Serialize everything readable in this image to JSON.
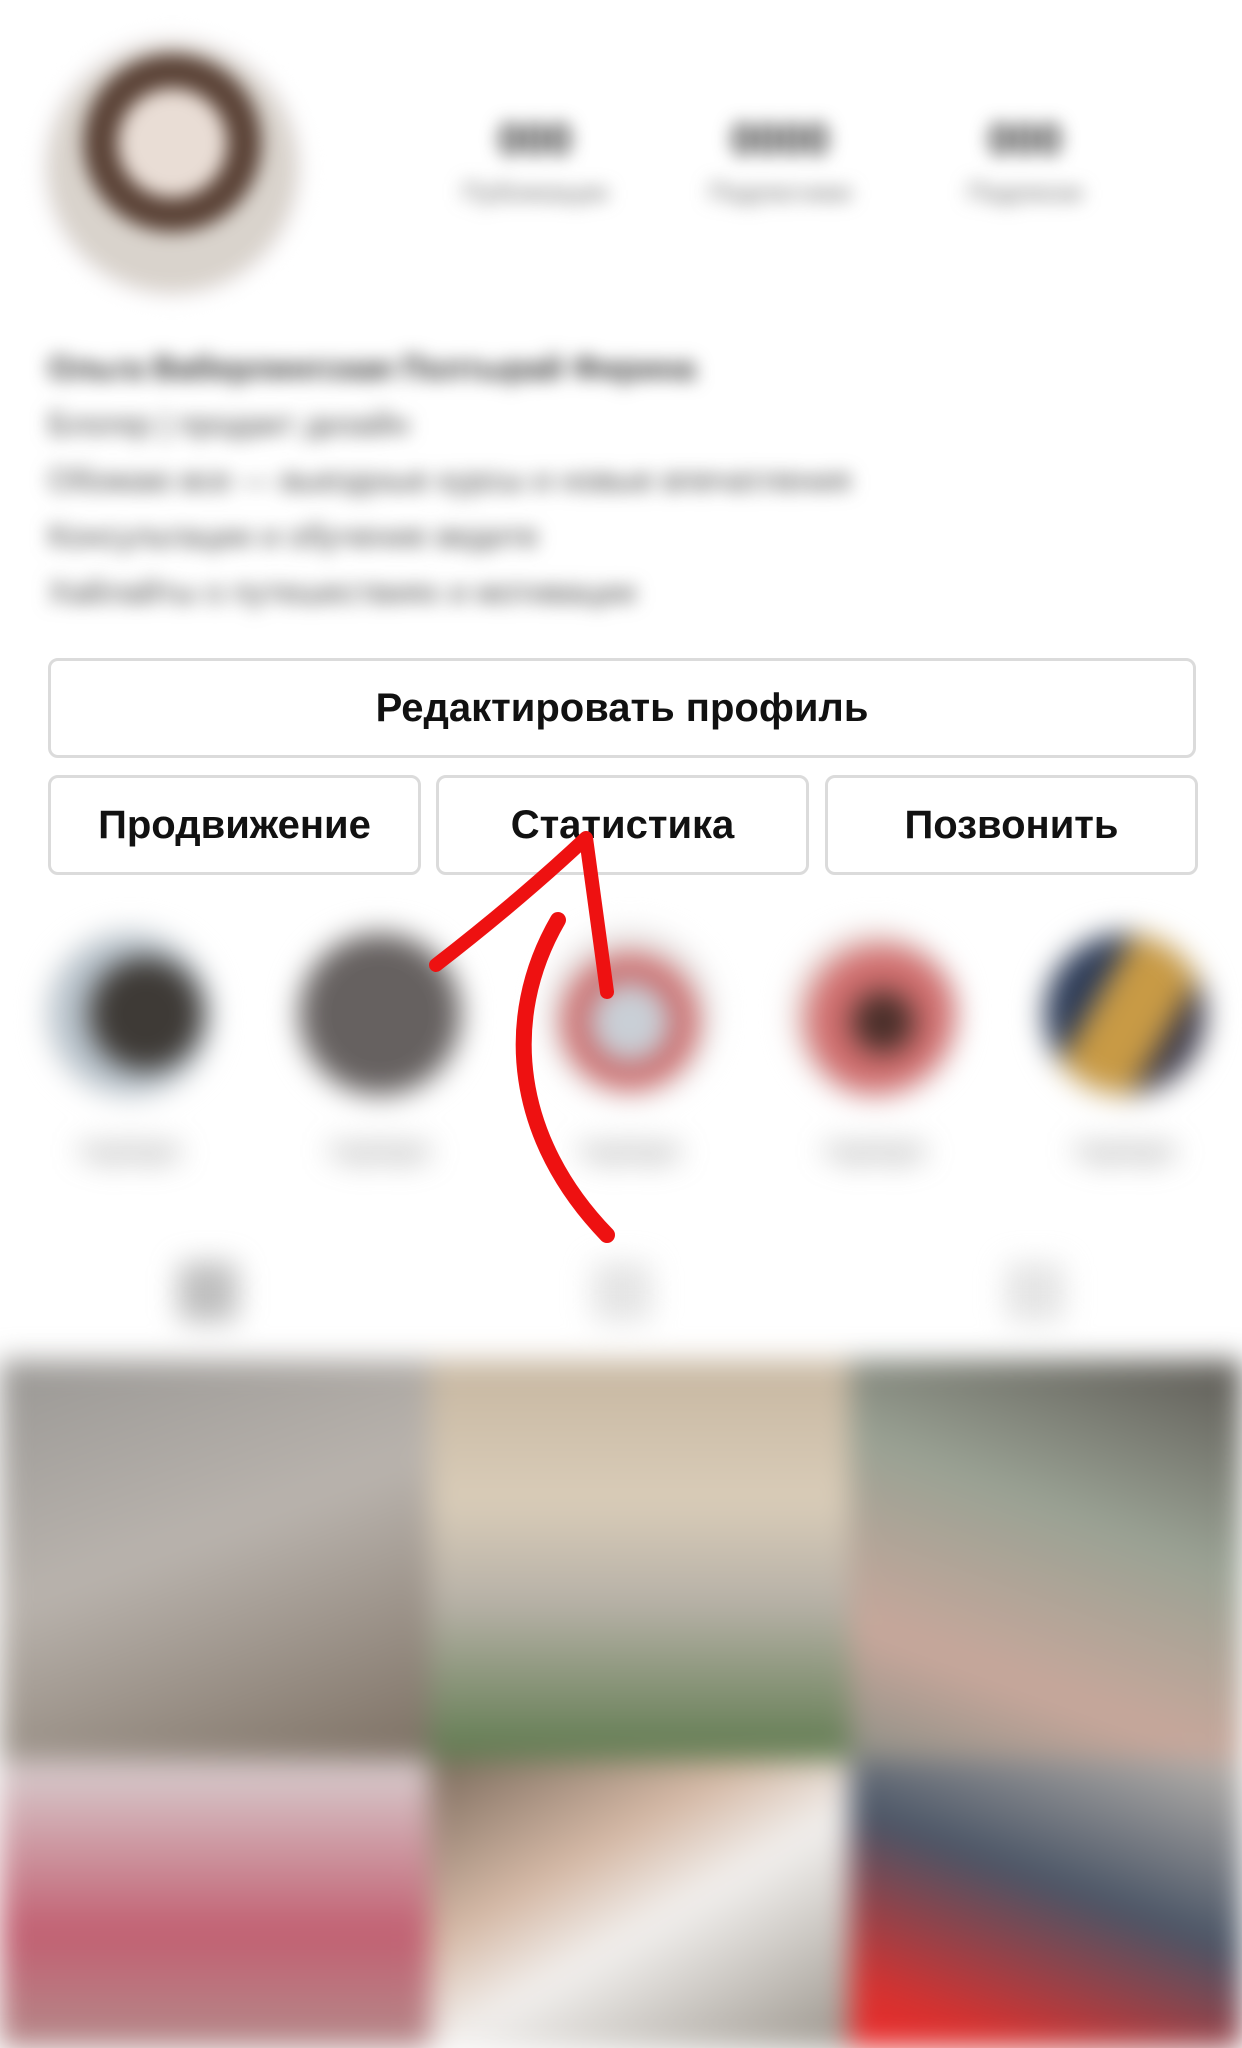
{
  "profile": {
    "stats": [
      {
        "value": "000",
        "label": "Публикации"
      },
      {
        "value": "0000",
        "label": "Подписчики"
      },
      {
        "value": "000",
        "label": "Подписки"
      }
    ],
    "bio_lines": [
      "Ольга Ваберлингская Полтырай Фирина",
      "Блогер | продакт дизайн",
      "Обожаю все — выездные курсы и новые впечатления",
      "Консультации и обучение ведите",
      "Хайлайты о путешествиях и мотивации"
    ]
  },
  "actions": {
    "edit_profile": "Редактировать профиль",
    "promotion": "Продвижение",
    "insights": "Статистика",
    "call": "Позвонить"
  },
  "highlights": [
    {
      "label": "Highlight"
    },
    {
      "label": "Highlight"
    },
    {
      "label": "Highlight"
    },
    {
      "label": "Highlight"
    },
    {
      "label": "Highlight"
    }
  ],
  "colors": {
    "arrow": "#ee1111",
    "button_border": "#dbdbdb",
    "text": "#111111"
  }
}
